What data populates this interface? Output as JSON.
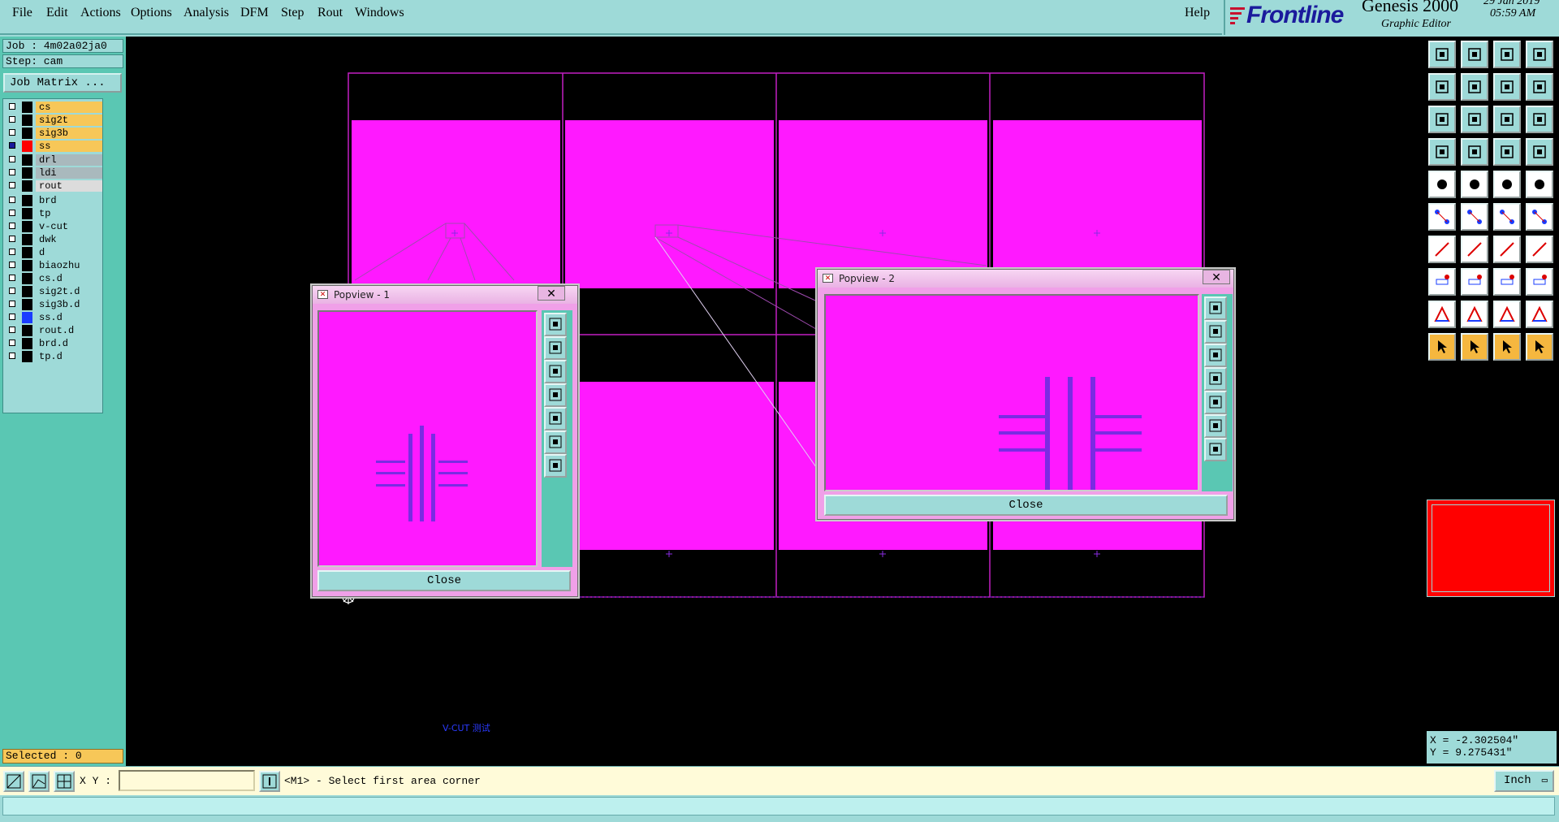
{
  "menubar": {
    "items": [
      "File",
      "Edit",
      "Actions",
      "Options",
      "Analysis",
      "DFM",
      "Step",
      "Rout",
      "Windows"
    ],
    "help": "Help"
  },
  "brand": {
    "logo": "Frontline",
    "product": "Genesis 2000",
    "subtitle": "Graphic Editor",
    "date": "29 Jan 2019",
    "time": "05:59 AM"
  },
  "job": {
    "job_line": "Job : 4m02a02ja0",
    "step_line": "Step: cam",
    "matrix_button": "Job Matrix ..."
  },
  "layers": [
    {
      "name": "cs",
      "bg": "#f7c758",
      "swatch": "#000000",
      "active": false
    },
    {
      "name": "sig2t",
      "bg": "#f7c758",
      "swatch": "#000000",
      "active": false
    },
    {
      "name": "sig3b",
      "bg": "#f7c758",
      "swatch": "#000000",
      "active": false
    },
    {
      "name": "ss",
      "bg": "#f7c758",
      "swatch": "#ff0000",
      "active": true
    },
    {
      "name": "drl",
      "bg": "#a9b9bd",
      "swatch": "#000000",
      "active": false
    },
    {
      "name": "ldi",
      "bg": "#a9b9bd",
      "swatch": "#000000",
      "active": false
    },
    {
      "name": "rout",
      "bg": "#dcdcdc",
      "swatch": "#000000",
      "active": false
    },
    {
      "name": "brd",
      "bg": "#9edad8",
      "swatch": "#000000",
      "active": false
    },
    {
      "name": "tp",
      "bg": "#9edad8",
      "swatch": "#000000",
      "active": false
    },
    {
      "name": "v-cut",
      "bg": "#9edad8",
      "swatch": "#000000",
      "active": false
    },
    {
      "name": "dwk",
      "bg": "#9edad8",
      "swatch": "#000000",
      "active": false
    },
    {
      "name": "d",
      "bg": "#9edad8",
      "swatch": "#000000",
      "active": false
    },
    {
      "name": "biaozhu",
      "bg": "#9edad8",
      "swatch": "#000000",
      "active": false
    },
    {
      "name": "cs.d",
      "bg": "#9edad8",
      "swatch": "#000000",
      "active": false
    },
    {
      "name": "sig2t.d",
      "bg": "#9edad8",
      "swatch": "#000000",
      "active": false
    },
    {
      "name": "sig3b.d",
      "bg": "#9edad8",
      "swatch": "#000000",
      "active": false
    },
    {
      "name": "ss.d",
      "bg": "#9edad8",
      "swatch": "#1a3cff",
      "active": false
    },
    {
      "name": "rout.d",
      "bg": "#9edad8",
      "swatch": "#000000",
      "active": false
    },
    {
      "name": "brd.d",
      "bg": "#9edad8",
      "swatch": "#000000",
      "active": false
    },
    {
      "name": "tp.d",
      "bg": "#9edad8",
      "swatch": "#000000",
      "active": false
    }
  ],
  "selected": "Selected : 0",
  "canvas": {
    "footer_label": "V-CUT 测试",
    "layer_color": "#ff19ff",
    "feature_color": "#8a2be2"
  },
  "popview1": {
    "title": "Popview - 1",
    "close_label": "Close"
  },
  "popview2": {
    "title": "Popview - 2",
    "close_label": "Close"
  },
  "coords": {
    "x": "X = -2.302504\"",
    "y": "Y = 9.275431\""
  },
  "bottom": {
    "xy_label": "X Y :",
    "xy_value": "",
    "prompt": "<M1> - Select first area corner",
    "units": "Inch"
  },
  "colors": {
    "panel": "#9edad8",
    "accent": "#5ac7b3",
    "magenta": "#ff19ff",
    "highlight": "#f7c758"
  }
}
